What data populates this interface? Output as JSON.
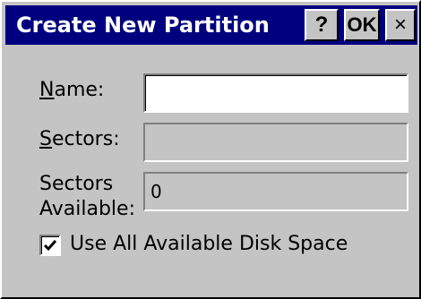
{
  "window": {
    "title": "Create New Partition",
    "help_label": "?",
    "ok_label": "OK",
    "close_label": "×"
  },
  "form": {
    "name": {
      "label": "Name:",
      "value": ""
    },
    "sectors": {
      "label": "Sectors:",
      "value": ""
    },
    "sectors_available": {
      "label": "Sectors Available:",
      "value": "0"
    },
    "use_all_space": {
      "label": "Use All Available Disk Space",
      "checked": true
    }
  },
  "colors": {
    "titlebar": "#01007f",
    "face": "#c4c4c4",
    "field_bg": "#ffffff"
  }
}
